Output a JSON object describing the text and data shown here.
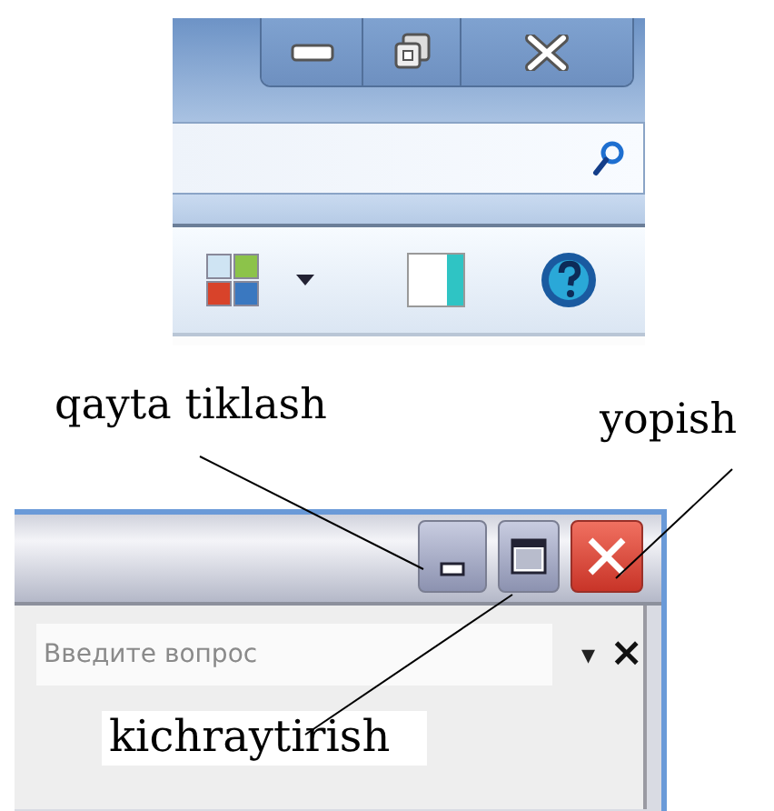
{
  "explorer": {
    "title_buttons": [
      {
        "kind": "minimize"
      },
      {
        "kind": "restore"
      },
      {
        "kind": "close"
      }
    ],
    "search": {
      "kind": "search"
    },
    "toolbar": [
      {
        "kind": "views"
      },
      {
        "kind": "dropdown"
      },
      {
        "kind": "preview"
      },
      {
        "kind": "help"
      }
    ]
  },
  "annotations": [
    {
      "text": "qayta tiklash"
    },
    {
      "text": "yopish"
    },
    {
      "text": "kichraytirish"
    }
  ],
  "office_window": {
    "title_buttons": [
      {
        "kind": "minimize"
      },
      {
        "kind": "maximize"
      },
      {
        "kind": "close"
      }
    ],
    "help_search": {
      "placeholder": "Введите вопрос",
      "dropdown": "▾",
      "close": "×"
    }
  }
}
